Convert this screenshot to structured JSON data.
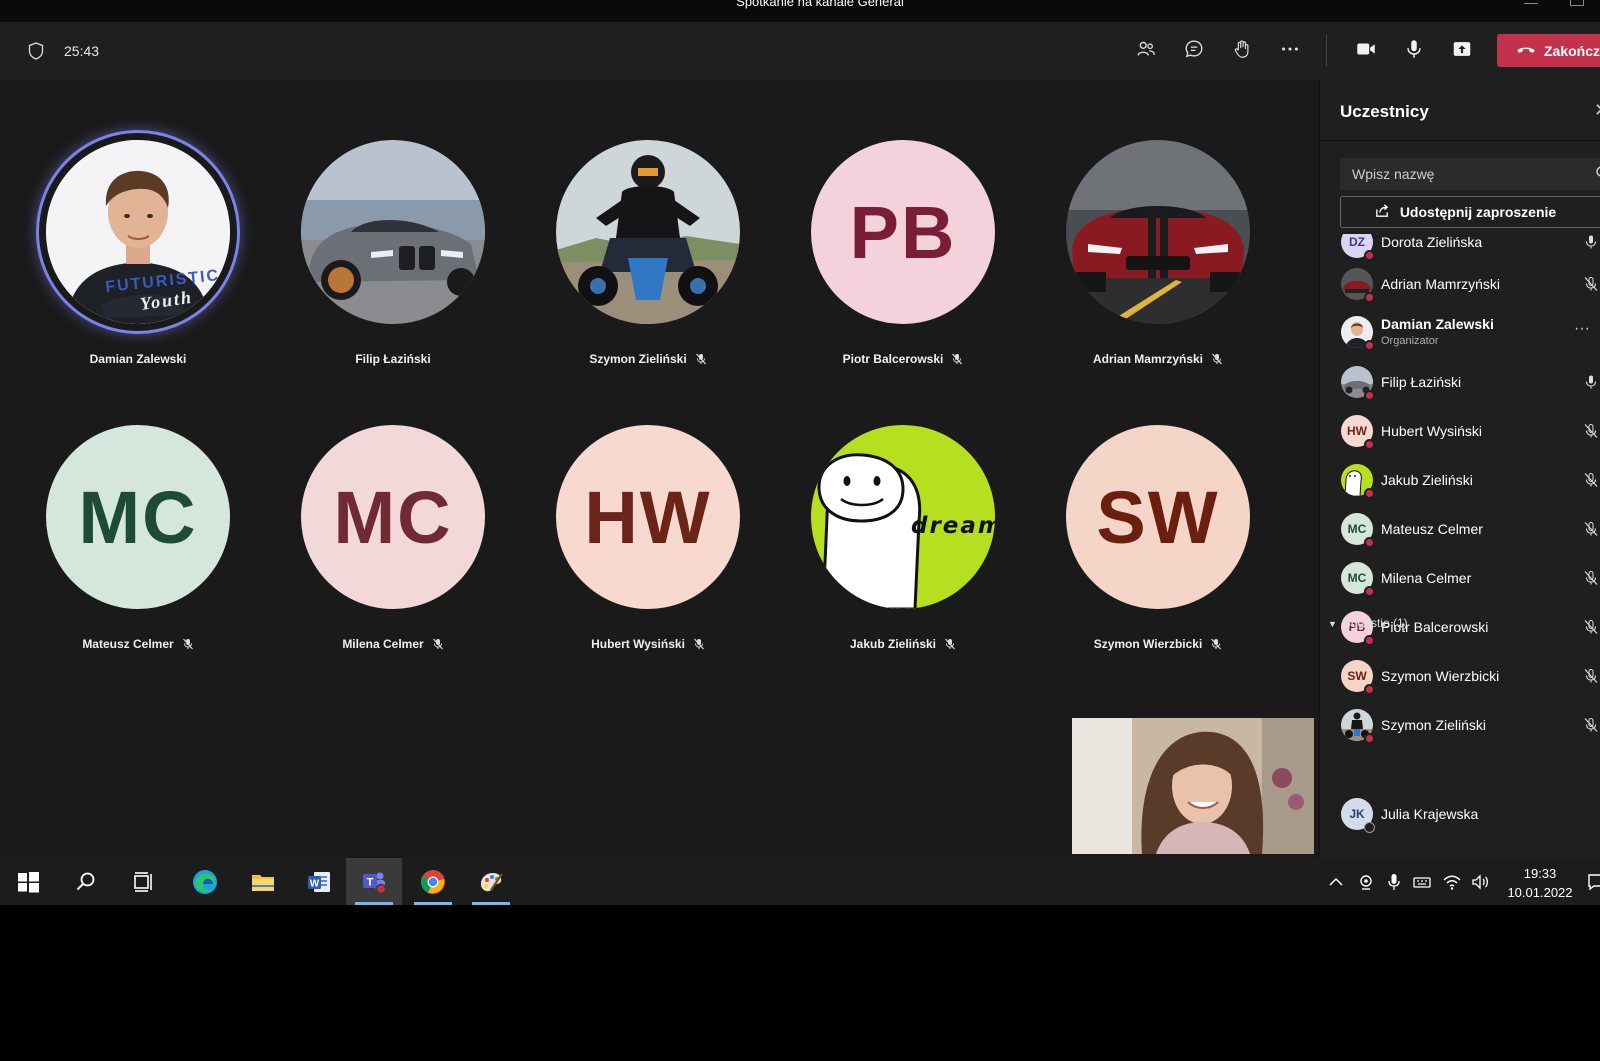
{
  "window": {
    "title": "Spotkanie na kanale General"
  },
  "toolbar": {
    "timer": "25:43",
    "end_call_label": "Zakończ"
  },
  "stage": {
    "tiles": [
      {
        "name": "Damian Zalewski",
        "muted": false,
        "speaking": true,
        "avatar": "photo-man"
      },
      {
        "name": "Filip Łaziński",
        "muted": false,
        "avatar": "photo-grey-car"
      },
      {
        "name": "Szymon Zieliński",
        "muted": true,
        "avatar": "photo-quad"
      },
      {
        "name": "Piotr Balcerowski",
        "muted": true,
        "initials": "PB",
        "bg": "#f4d2dc",
        "fg": "#7a1d36"
      },
      {
        "name": "Adrian Mamrzyński",
        "muted": true,
        "avatar": "photo-red-car"
      },
      {
        "name": "Mateusz Celmer",
        "muted": true,
        "initials": "MC",
        "bg": "#d5e6dc",
        "fg": "#1e4b33"
      },
      {
        "name": "Milena Celmer",
        "muted": true,
        "initials": "MC",
        "bg": "#f2d8d8",
        "fg": "#6f2a33"
      },
      {
        "name": "Hubert Wysiński",
        "muted": true,
        "initials": "HW",
        "bg": "#f7d9cf",
        "fg": "#6b2418"
      },
      {
        "name": "Jakub Zieliński",
        "muted": true,
        "avatar": "dream-logo",
        "logo_text": "dream"
      },
      {
        "name": "Szymon Wierzbicki",
        "muted": true,
        "initials": "SW",
        "bg": "#f5d5c8",
        "fg": "#6b200f"
      }
    ]
  },
  "panel": {
    "title": "Uczestnicy",
    "search_placeholder": "Wpisz nazwę",
    "share_label": "Udostępnij zaproszenie",
    "participants": [
      {
        "name": "Dorota Zielińska",
        "initials": "DZ",
        "mic": "on"
      },
      {
        "name": "Adrian Mamrzyński",
        "avatar": "red-car",
        "mic": "off"
      },
      {
        "name": "Damian Zalewski",
        "role": "Organizator",
        "avatar": "man",
        "mic": "more"
      },
      {
        "name": "Filip Łaziński",
        "avatar": "grey-car",
        "mic": "on"
      },
      {
        "name": "Hubert Wysiński",
        "initials": "HW",
        "mic": "off"
      },
      {
        "name": "Jakub Zieliński",
        "avatar": "dream",
        "mic": "off"
      },
      {
        "name": "Mateusz Celmer",
        "initials": "MC",
        "mic": "off"
      },
      {
        "name": "Milena Celmer",
        "initials": "MC",
        "mic": "off"
      },
      {
        "name": "Piotr Balcerowski",
        "initials": "PB",
        "mic": "off"
      },
      {
        "name": "Szymon Wierzbicki",
        "initials": "SW",
        "mic": "off"
      },
      {
        "name": "Szymon Zieliński",
        "avatar": "quad",
        "mic": "off"
      }
    ],
    "suggestions_label": "Sugestie (1)",
    "suggestions": [
      {
        "name": "Julia Krajewska",
        "initials": "JK"
      }
    ]
  },
  "taskbar": {
    "time": "19:33",
    "date": "10.01.2022"
  },
  "colors": {
    "accent": "#7b83eb",
    "end_call": "#c4314b",
    "status_busy": "#c4314b"
  }
}
